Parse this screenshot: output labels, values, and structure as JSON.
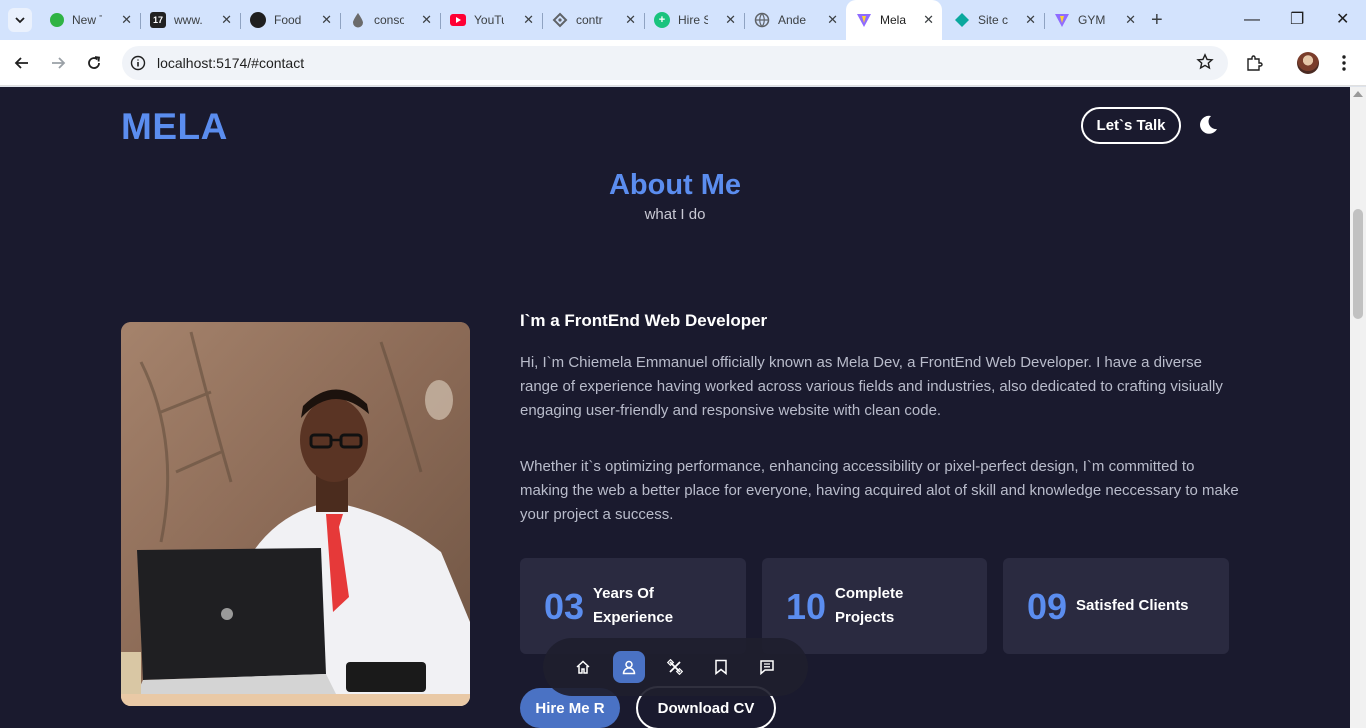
{
  "browser": {
    "tabs": [
      {
        "label": "New T",
        "icon": "green-dot-icon",
        "color": "#2fb344"
      },
      {
        "label": "www.",
        "icon": "site-17-icon",
        "color": "#222222"
      },
      {
        "label": "Food",
        "icon": "github-icon",
        "color": "#1f1f1f"
      },
      {
        "label": "conso",
        "icon": "drop-icon",
        "color": "#6b6b6b"
      },
      {
        "label": "YouTu",
        "icon": "youtube-icon",
        "color": "#ff0033"
      },
      {
        "label": "contr",
        "icon": "diamond-icon",
        "color": "#5f6368"
      },
      {
        "label": "Hire S",
        "icon": "green-badge-icon",
        "color": "#19c37d"
      },
      {
        "label": "Ande",
        "icon": "globe-icon",
        "color": "#5f6368"
      },
      {
        "label": "Mela",
        "icon": "vite-icon",
        "color": "#8f6bff",
        "active": true
      },
      {
        "label": "Site c",
        "icon": "teal-diamond-icon",
        "color": "#0aa89e"
      },
      {
        "label": "GYM",
        "icon": "vite-icon",
        "color": "#8f6bff"
      }
    ],
    "url": "localhost:5174/#contact"
  },
  "header": {
    "logo": "MELA",
    "talk_button": "Let`s Talk",
    "theme_icon": "moon-icon"
  },
  "about": {
    "title": "About Me",
    "subtitle": "what I do",
    "role": "I`m a FrontEnd Web Developer",
    "paragraph1": "Hi, I`m Chiemela Emmanuel officially known as Mela Dev, a FrontEnd Web Developer. I have a diverse range of experience having worked across various fields and industries, also dedicated to crafting visiually engaging user-friendly and responsive website with clean code.",
    "paragraph2": "Whether it`s optimizing performance, enhancing accessibility or pixel-perfect design, I`m committed to making the web a better place for everyone, having acquired alot of skill and knowledge neccessary to make your project a success."
  },
  "stats": [
    {
      "number": "03",
      "line1": "Years Of",
      "line2": "Experience"
    },
    {
      "number": "10",
      "line1": "Complete",
      "line2": "Projects"
    },
    {
      "number": "09",
      "line1": "Satisfed Clients",
      "line2": ""
    }
  ],
  "dock": {
    "items": [
      {
        "icon": "home-icon"
      },
      {
        "icon": "user-icon",
        "active": true
      },
      {
        "icon": "tools-icon"
      },
      {
        "icon": "bookmark-icon"
      },
      {
        "icon": "message-icon"
      }
    ]
  },
  "actions": {
    "hire": "Hire Me R",
    "cv": "Download CV"
  },
  "colors": {
    "page_bg": "#1a1a2e",
    "accent": "#5b8def",
    "card_bg": "#2a2a40"
  }
}
